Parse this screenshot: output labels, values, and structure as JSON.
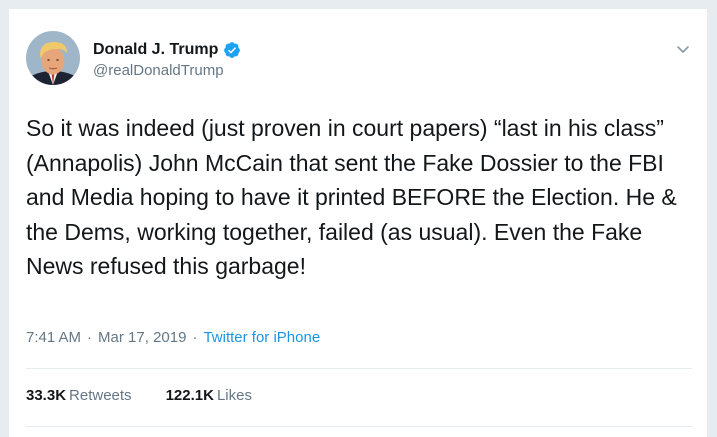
{
  "colors": {
    "background": "#e6ecf0",
    "card": "#ffffff",
    "text": "#14171a",
    "secondary": "#657786",
    "link": "#1b95e0",
    "verified": "#1da1f2"
  },
  "author": {
    "name": "Donald J. Trump",
    "handle": "@realDonaldTrump",
    "verified_icon": "verified-badge-icon",
    "avatar_icon": "avatar"
  },
  "menu": {
    "icon": "chevron-down-icon"
  },
  "tweet": {
    "text": "So it was indeed (just proven in court papers) “last in his class” (Annapolis) John McCain that sent the Fake Dossier to the FBI and Media hoping to have it printed BEFORE the Election. He & the Dems, working together, failed (as usual). Even the Fake News refused this garbage!",
    "time": "7:41 AM",
    "separator1": "·",
    "date": "Mar 17, 2019",
    "separator2": "·",
    "source": "Twitter for iPhone"
  },
  "stats": {
    "retweets_count": "33.3K",
    "retweets_label": "Retweets",
    "likes_count": "122.1K",
    "likes_label": "Likes"
  }
}
